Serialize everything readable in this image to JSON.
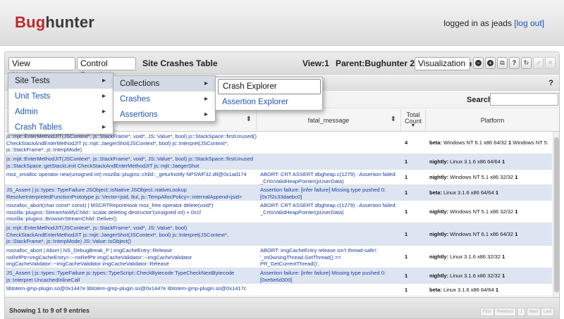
{
  "header": {
    "logo_bug": "Bug",
    "logo_hunter": "hunter",
    "login_text": "logged in as jeads",
    "logout_link": "[log out]"
  },
  "toolbar": {
    "view_nav_label": "View Navigation",
    "control_panel_label": "Control Panel",
    "title": "Site Crashes Table",
    "view": "View:1",
    "parent": "Parent:Bughunter 2",
    "visualization_label": "Visualization",
    "icons": [
      "minus-circle-icon",
      "plus-circle-icon",
      "copy-icon",
      "help-icon",
      "refresh-icon",
      "link-icon",
      "close-icon"
    ],
    "help_glyph": "?"
  },
  "subbar": {
    "help": "?"
  },
  "search": {
    "label": "Search:",
    "value": ""
  },
  "menus": {
    "level1": [
      {
        "label": "Site Tests",
        "chevron": "▸"
      },
      {
        "label": "Unit Tests",
        "chevron": "▸"
      },
      {
        "label": "Admin",
        "chevron": "▸"
      },
      {
        "label": "Crash Tables",
        "chevron": "▸"
      }
    ],
    "level2": [
      {
        "label": "Collections",
        "chevron": "▸"
      },
      {
        "label": "Crashes",
        "chevron": "▸"
      },
      {
        "label": "Assertions",
        "chevron": "▸"
      }
    ],
    "level3": [
      {
        "label": "Crash Explorer"
      },
      {
        "label": "Assertion Explorer"
      }
    ]
  },
  "table": {
    "columns": {
      "fatal_message": "fatal_message",
      "total_count_1": "Total",
      "total_count_2": "Count",
      "platform": "Platform"
    },
    "rows": [
      {
        "signature": "js::mjit::EnterMethodJIT(JSContext*, js::StackFrame*, void*, JS::Value*, bool) js::StackSpace::firstUnused() CheckStackAndEnterMethodJIT js::mjit::JaegerShot(JSContext*, bool) js::Interpret(JSContext*, js::StackFrame*, js::InterpMode)",
        "message": "",
        "count": "4",
        "platform_b": "beta:",
        "platform_t": "Windows NT 6.1 x86 64/32",
        "platform_n": "1",
        "platform_extra": "Windows NT 5."
      },
      {
        "signature": "js::mjit::EnterMethodJIT(JSContext*, js::StackFrame*, void*, JS::Value*, bool) js::StackSpace::firstUnused js::StackSpace::getStackLimit CheckStackAndEnterMethodJIT js::mjit::JaegerShot",
        "message": "",
        "count": "1",
        "platform_b": "nightly:",
        "platform_t": "Linux 3.1.6 x86 64/64",
        "platform_n": "1",
        "platform_extra": ""
      },
      {
        "signature": "moz_xmalloc operator new(unsigned int) mozilla::plugins::child::_geturlnotify NPSWF32.dll@0x1ad174",
        "message": "ABORT: CRT ASSERT dbgheap.c(1279) : Assertion failed: _CrtIsValidHeapPointer(pUserData)",
        "count": "1",
        "platform_b": "nightly:",
        "platform_t": "Windows NT 5.1 x86 32/32",
        "platform_n": "1",
        "platform_extra": ""
      },
      {
        "signature": "JS_Assert | js::types::TypeFailure JSObject::isNative JSObject::nativeLookup ResolveInterpretedFunctionPrototype js::Vector<jsid, 8ul, js::TempAllocPolicy>::internalAppend<jsid>",
        "message": "Assertion failure: [infer failure] Missing type pushed 0: [0x7f2c33daebc0]",
        "count": "1",
        "platform_b": "beta:",
        "platform_t": "Linux 3.1.6 x86 64/64",
        "platform_n": "1",
        "platform_extra": ""
      },
      {
        "signature": "mozalloc_abort(char const* const) | MSCRTReportHook moz_free operator delete(void*) mozilla::plugins::StreamNotifyChild::`scalar deleting destructor'(unsigned int) + 0x1f mozilla::plugins::BrowserStreamChild::Deliver()",
        "message": "ABORT: CRT ASSERT dbgheap.c(1279) : Assertion failed: _CrtIsValidHeapPointer(pUserData)",
        "count": "1",
        "platform_b": "nightly:",
        "platform_t": "Windows NT 5.1 x86 32/32",
        "platform_n": "1",
        "platform_extra": ""
      },
      {
        "signature": "js::mjit::EnterMethodJIT(JSContext*, js::StackFrame*, void*, JS::Value*, bool) CheckStackAndEnterMethodJIT js::mjit::JaegerShot(JSContext*, bool) js::Interpret(JSContext*, js::StackFrame*, js::InterpMode) JS::Value::isObject()",
        "message": "",
        "count": "1",
        "platform_b": "nightly:",
        "platform_t": "Windows NT 6.1 x86 64/32",
        "platform_n": "1",
        "platform_extra": ""
      },
      {
        "signature": "mozalloc_abort | Abort | NS_DebugBreak_P | imgCacheEntry::Release nsRefPtr<imgCacheEntry>::~nsRefPtr imgCacheValidator::~imgCacheValidator imgCacheValidator::~imgCacheValidator imgCacheValidator::Release",
        "message": "ABORT: imgCacheEntry release isn't thread-safe!: '_mOwningThread.GetThread() == PR_GetCurrentThread()',",
        "count": "1",
        "platform_b": "nightly:",
        "platform_t": "Linux 3.1.6 x86 32/32",
        "platform_n": "1",
        "platform_extra": ""
      },
      {
        "signature": "JS_Assert | js::types::TypeFailure js::types::TypeScript::CheckBytecode TypeCheckNextBytecode js::Interpret UncachedInlineCall",
        "message": "Assertion failure: [infer failure] Missing type pushed 0: [0xe6e6d300]",
        "count": "1",
        "platform_b": "nightly:",
        "platform_t": "Linux 3.1.6 x86 32/32",
        "platform_n": "1",
        "platform_extra": ""
      },
      {
        "signature": "libtotem-gmp-plugin.so@0x1447e libtotem-gmp-plugin.so@0x1447e libtotem-gmp-plugin.so@0x1417c",
        "message": "",
        "count": "1",
        "platform_b": "beta:",
        "platform_t": "Linux 3.1.6 x86 64/64",
        "platform_n": "1",
        "platform_extra": ""
      }
    ]
  },
  "footer": {
    "showing": "Showing 1 to 9 of 9 entries",
    "pager": [
      "First",
      "Previous",
      "1",
      "Next",
      "Last"
    ]
  }
}
